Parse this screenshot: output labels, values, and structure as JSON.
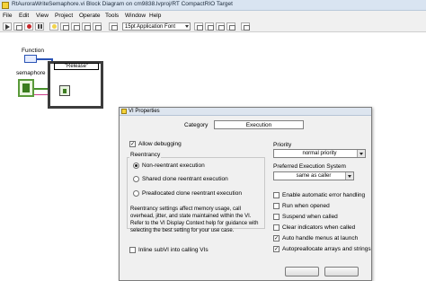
{
  "window": {
    "title": "RtAuroraWriteSemaphore.vi Block Diagram on cm9838.lvproj/RT CompactRIO Target"
  },
  "menubar": {
    "items": [
      "File",
      "Edit",
      "View",
      "Project",
      "Operate",
      "Tools",
      "Window",
      "Help"
    ]
  },
  "toolbar": {
    "font_select": "15pt Application Font"
  },
  "diagram": {
    "function_label": "Function",
    "semaphore_label": "semaphore",
    "case_selector": "\"Release\"",
    "wire_colors": {
      "enum": "#2a53b5",
      "refnum": "#47902a",
      "error": "#cc3f8a"
    }
  },
  "dialog": {
    "title": "VI Properties",
    "category_label": "Category",
    "category_value": "Execution",
    "allow_debugging": {
      "label": "Allow debugging",
      "checked": true
    },
    "reentrancy": {
      "heading": "Reentrancy",
      "options": [
        {
          "label": "Non-reentrant execution",
          "selected": true
        },
        {
          "label": "Shared clone reentrant execution",
          "selected": false
        },
        {
          "label": "Preallocated clone reentrant execution",
          "selected": false
        }
      ],
      "note": "Reentrancy settings affect memory usage, call overhead, jitter, and state maintained within the VI. Refer to the VI Display Context help for guidance with selecting the best setting for your use case."
    },
    "inline_subvi": {
      "label": "Inline subVI into calling VIs",
      "checked": false
    },
    "priority": {
      "label": "Priority",
      "value": "normal priority"
    },
    "exec_system": {
      "label": "Preferred Execution System",
      "value": "same as caller"
    },
    "right_options": [
      {
        "label": "Enable automatic error handling",
        "checked": false
      },
      {
        "label": "Run when opened",
        "checked": false
      },
      {
        "label": "Suspend when called",
        "checked": false
      },
      {
        "label": "Clear indicators when called",
        "checked": false
      },
      {
        "label": "Auto handle menus at launch",
        "checked": true
      },
      {
        "label": "Autopreallocate arrays and strings",
        "checked": true
      }
    ]
  }
}
